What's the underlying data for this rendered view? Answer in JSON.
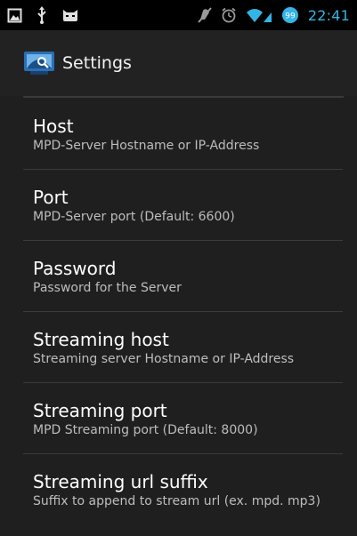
{
  "status_bar": {
    "left_icons": [
      "gallery-icon",
      "usb-icon",
      "android-debug-icon"
    ],
    "right_icons": [
      "mute-icon",
      "alarm-icon",
      "wifi-signal-icon",
      "battery-icon"
    ],
    "battery_level": "99",
    "time": "22:41",
    "accent_color": "#33b5e5"
  },
  "action_bar": {
    "title": "Settings",
    "app_icon": "settings-app-icon"
  },
  "preferences": [
    {
      "title": "Host",
      "summary": "MPD-Server Hostname or IP-Address"
    },
    {
      "title": "Port",
      "summary": "MPD-Server port (Default: 6600)"
    },
    {
      "title": "Password",
      "summary": "Password for the Server"
    },
    {
      "title": "Streaming host",
      "summary": "Streaming server Hostname or IP-Address"
    },
    {
      "title": "Streaming port",
      "summary": "MPD Streaming port (Default: 8000)"
    },
    {
      "title": "Streaming url suffix",
      "summary": "Suffix to append to stream url (ex. mpd. mp3)"
    }
  ]
}
